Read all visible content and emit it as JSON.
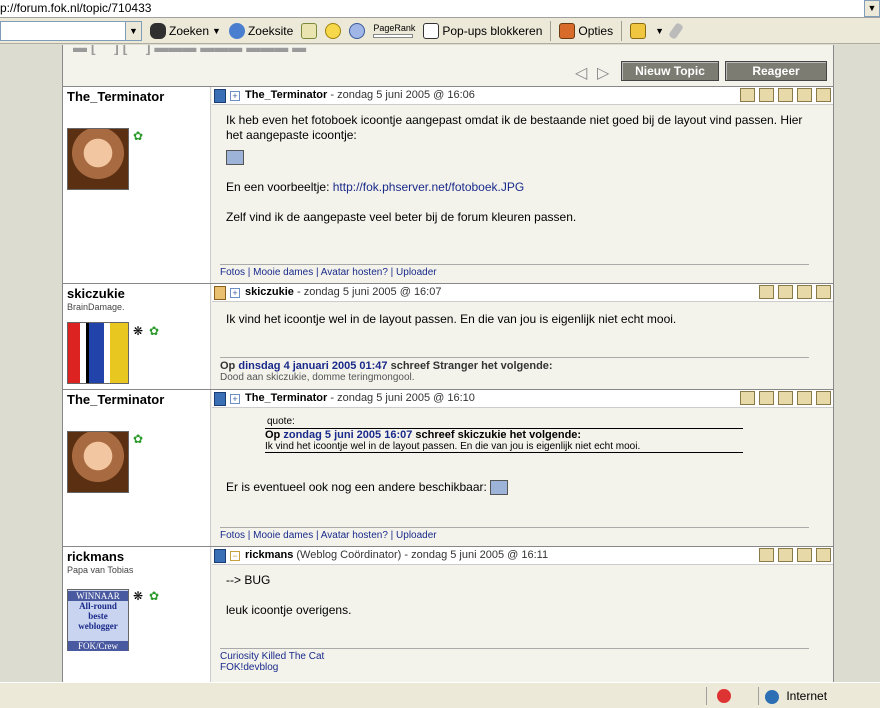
{
  "browser": {
    "address": "p://forum.fok.nl/topic/710433",
    "toolbar": {
      "zoeken": "Zoeken",
      "zoeksite": "Zoeksite",
      "pagerank": "PageRank",
      "popups": "Pop-ups blokkeren",
      "opties": "Opties"
    }
  },
  "topic": {
    "nieuw_topic": "Nieuw Topic",
    "reageer": "Reageer"
  },
  "posts": [
    {
      "username": "The_Terminator",
      "usertitle": "",
      "header_name": "The_Terminator",
      "header_meta": " - zondag 5 juni 2005 @ 16:06",
      "lines": [
        "Ik heb even het fotoboek icoontje aangepast omdat ik de bestaande niet goed bij de layout vind passen. Hier het aangepaste icoontje:"
      ],
      "example_prefix": "En een voorbeeltje: ",
      "example_link": "http://fok.phserver.net/fotoboek.JPG",
      "closing": "Zelf vind ik de aangepaste veel beter bij de forum kleuren passen.",
      "signature": "Fotos | Mooie dames | Avatar hosten? | Uploader"
    },
    {
      "username": "skiczukie",
      "usertitle": "BrainDamage.",
      "header_name": "skiczukie",
      "header_meta": " - zondag 5 juni 2005 @ 16:07",
      "text": "Ik vind het icoontje wel in de layout passen. En die van jou is eigenlijk niet echt mooi.",
      "sig_quote_prefix": "Op ",
      "sig_quote_date": "dinsdag 4 januari 2005 01:47",
      "sig_quote_suffix": " schreef Stranger het volgende:",
      "sig_quote_text": "Dood aan skiczukie, domme teringmongool."
    },
    {
      "username": "The_Terminator",
      "usertitle": "",
      "header_name": "The_Terminator",
      "header_meta": " - zondag 5 juni 2005 @ 16:10",
      "quote_label": "quote:",
      "quote_prefix": "Op ",
      "quote_date": "zondag 5 juni 2005 16:07",
      "quote_suffix": " schreef skiczukie het volgende:",
      "quote_text": "Ik vind het icoontje wel in de layout passen. En die van jou is eigenlijk niet echt mooi.",
      "text": "Er is eventueel ook nog een andere beschikbaar:",
      "signature": "Fotos | Mooie dames | Avatar hosten? | Uploader"
    },
    {
      "username": "rickmans",
      "usertitle": "Papa van Tobias",
      "header_name": "rickmans",
      "header_meta": " (Weblog Coördinator) - zondag 5 juni 2005 @ 16:11",
      "line1": "--> BUG",
      "line2": "leuk icoontje overigens.",
      "sig1": "Curiosity Killed The Cat",
      "sig2": "FOK!devblog",
      "avatar_lines": [
        "WINNAAR",
        "All-round",
        "beste",
        "weblogger",
        "FOK/Crew"
      ]
    }
  ],
  "statusbar": {
    "zone": "Internet"
  }
}
